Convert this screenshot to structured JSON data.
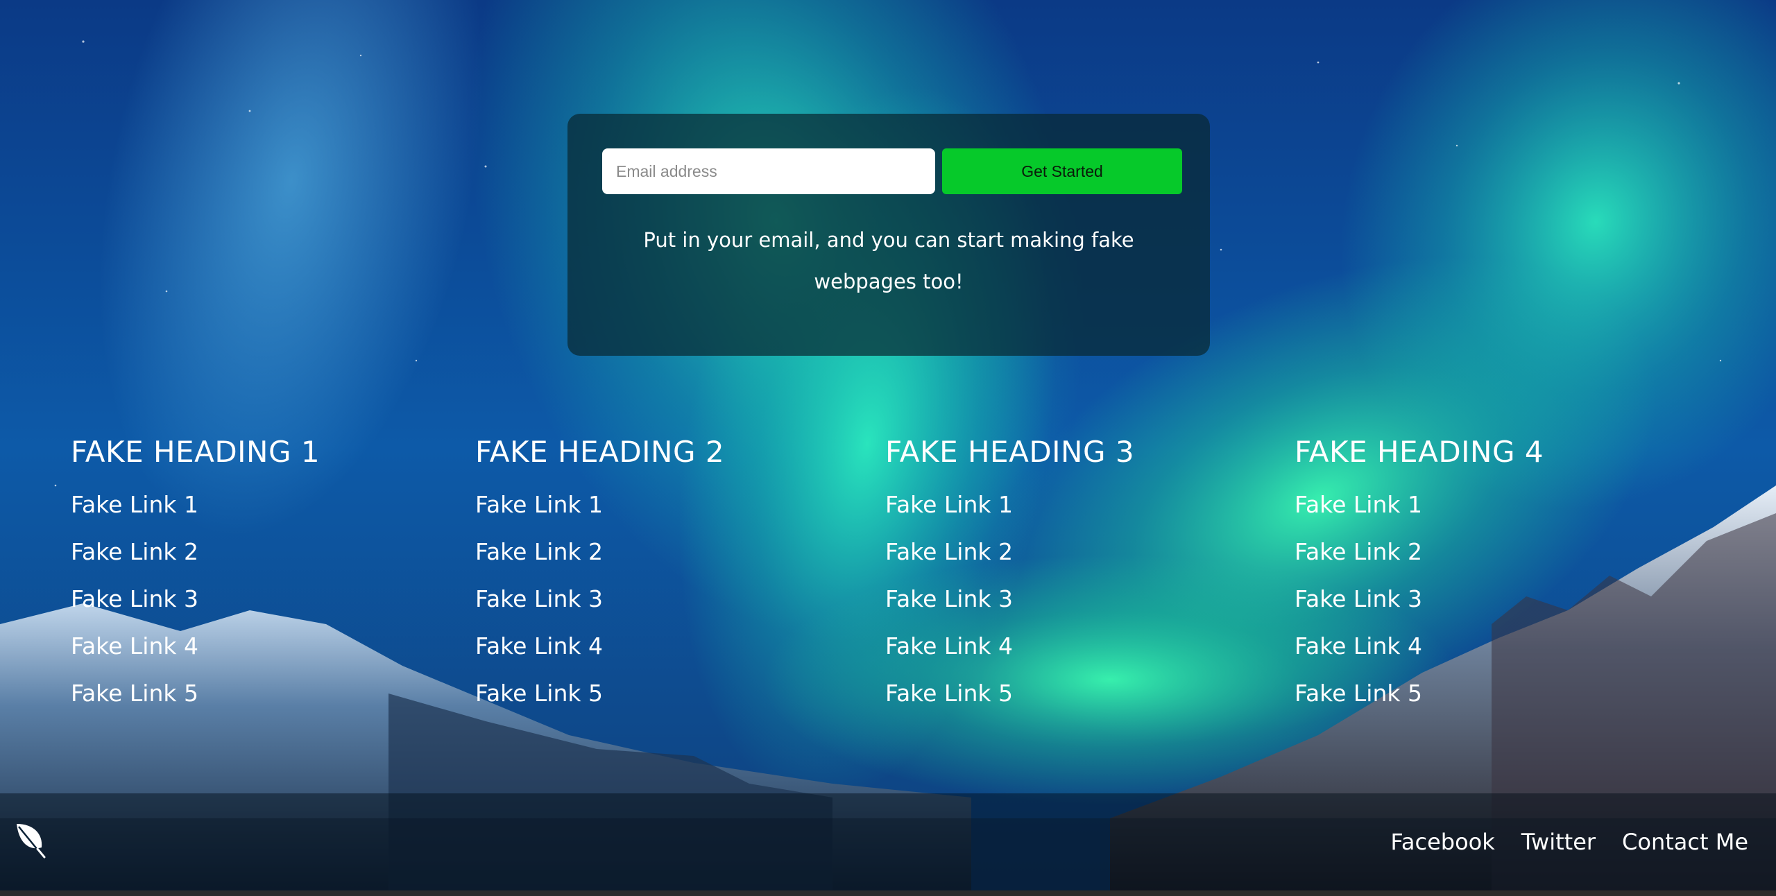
{
  "signup": {
    "email_placeholder": "Email address",
    "button_label": "Get Started",
    "description": "Put in your email, and you can start making fake webpages too!"
  },
  "columns": [
    {
      "heading": "FAKE HEADING 1",
      "links": [
        "Fake Link 1",
        "Fake Link 2",
        "Fake Link 3",
        "Fake Link 4",
        "Fake Link 5"
      ]
    },
    {
      "heading": "FAKE HEADING 2",
      "links": [
        "Fake Link 1",
        "Fake Link 2",
        "Fake Link 3",
        "Fake Link 4",
        "Fake Link 5"
      ]
    },
    {
      "heading": "FAKE HEADING 3",
      "links": [
        "Fake Link 1",
        "Fake Link 2",
        "Fake Link 3",
        "Fake Link 4",
        "Fake Link 5"
      ]
    },
    {
      "heading": "FAKE HEADING 4",
      "links": [
        "Fake Link 1",
        "Fake Link 2",
        "Fake Link 3",
        "Fake Link 4",
        "Fake Link 5"
      ]
    }
  ],
  "footer": {
    "logo_icon": "leaf-icon",
    "links": [
      "Facebook",
      "Twitter",
      "Contact Me"
    ]
  },
  "colors": {
    "button_green": "#06c92a",
    "card_bg": "rgba(8, 40, 50, 0.72)",
    "text": "#ffffff"
  }
}
